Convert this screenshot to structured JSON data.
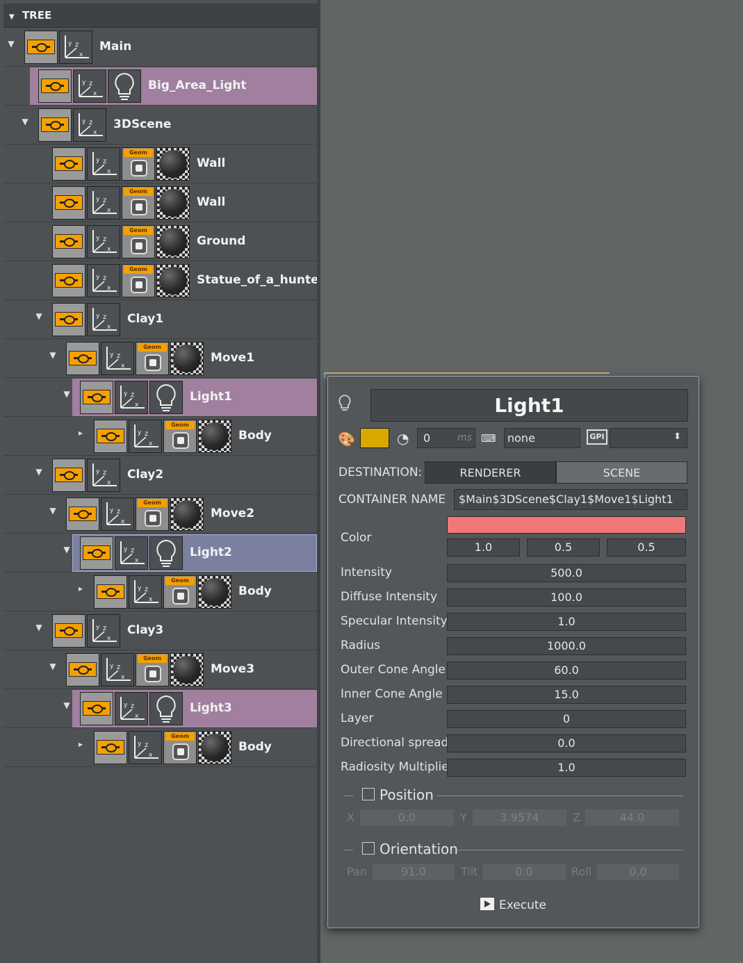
{
  "tree": {
    "header": "TREE",
    "rows": [
      {
        "label": "Main",
        "expander": "▼"
      },
      {
        "label": "Big_Area_Light",
        "expander": ""
      },
      {
        "label": "3DScene",
        "expander": "▼"
      },
      {
        "label": "Wall",
        "expander": ""
      },
      {
        "label": "Wall",
        "expander": ""
      },
      {
        "label": "Ground",
        "expander": ""
      },
      {
        "label": "Statue_of_a_hunter",
        "expander": ""
      },
      {
        "label": "Clay1",
        "expander": "▼"
      },
      {
        "label": "Move1",
        "expander": "▼"
      },
      {
        "label": "Light1",
        "expander": "▼"
      },
      {
        "label": "Body",
        "expander": "▸"
      },
      {
        "label": "Clay2",
        "expander": "▼"
      },
      {
        "label": "Move2",
        "expander": "▼"
      },
      {
        "label": "Light2",
        "expander": "▼"
      },
      {
        "label": "Body",
        "expander": "▸"
      },
      {
        "label": "Clay3",
        "expander": "▼"
      },
      {
        "label": "Move3",
        "expander": "▼"
      },
      {
        "label": "Light3",
        "expander": "▼"
      },
      {
        "label": "Body",
        "expander": "▸"
      }
    ],
    "geom_tag": "Geom",
    "icons": [
      "container-icon",
      "axes-icon",
      "bulb-icon",
      "geometry-icon",
      "material-icon"
    ]
  },
  "popup": {
    "title": "Light1",
    "color_swatch": "#d9a800",
    "delay_value": "0",
    "delay_unit": "ms",
    "keyboard_value": "none",
    "gpi_label": "GPI",
    "gpi_value": "",
    "destination_label": "DESTINATION:",
    "dest_renderer": "RENDERER",
    "dest_scene": "SCENE",
    "container_name_label": "CONTAINER NAME",
    "container_name_value": "$Main$3DScene$Clay1$Move1$Light1",
    "color_label": "Color",
    "color_preview": "#f07878",
    "color_r": "1.0",
    "color_g": "0.5",
    "color_b": "0.5",
    "props": [
      {
        "label": "Intensity",
        "value": "500.0"
      },
      {
        "label": "Diffuse Intensity",
        "value": "100.0"
      },
      {
        "label": "Specular Intensity",
        "value": "1.0"
      },
      {
        "label": "Radius",
        "value": "1000.0"
      },
      {
        "label": "Outer Cone Angle",
        "value": "60.0"
      },
      {
        "label": "Inner Cone Angle",
        "value": "15.0"
      },
      {
        "label": "Layer",
        "value": "0"
      },
      {
        "label": "Directional spread",
        "value": "0.0"
      },
      {
        "label": "Radiosity Multiplier",
        "value": "1.0"
      }
    ],
    "position": {
      "label": "Position",
      "x_label": "X",
      "x": "0.0",
      "y_label": "Y",
      "y": "3.9574",
      "z_label": "Z",
      "z": "44.0"
    },
    "orientation": {
      "label": "Orientation",
      "pan_label": "Pan",
      "pan": "91.0",
      "tilt_label": "Tilt",
      "tilt": "0.0",
      "roll_label": "Roll",
      "roll": "0.0"
    },
    "execute_label": "Execute"
  }
}
